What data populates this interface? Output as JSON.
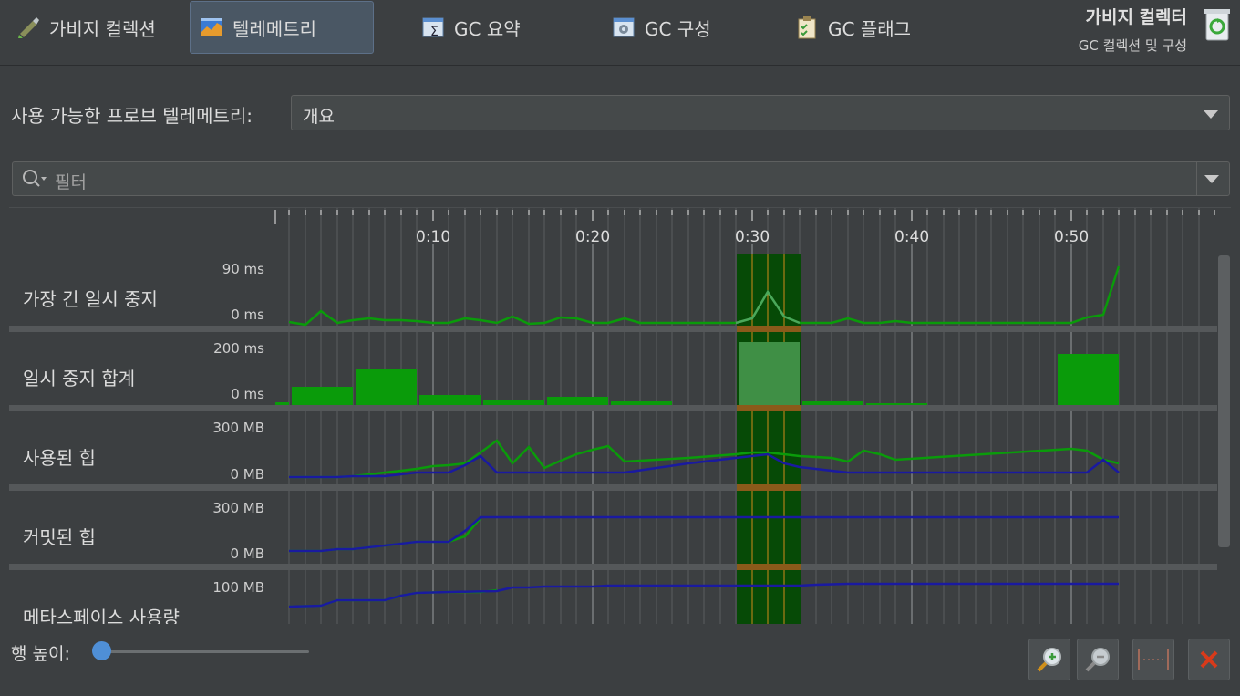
{
  "tabs": [
    {
      "label": "가비지 컬렉션",
      "icon": "garbage-collection-icon"
    },
    {
      "label": "텔레메트리",
      "icon": "telemetry-icon",
      "active": true
    },
    {
      "label": "GC 요약",
      "icon": "gc-summary-icon"
    },
    {
      "label": "GC 구성",
      "icon": "gc-config-icon"
    },
    {
      "label": "GC 플래그",
      "icon": "gc-flags-icon"
    }
  ],
  "header": {
    "title": "가비지 컬렉터",
    "subtitle": "GC 컬렉션 및 구성",
    "icon": "recycle-bin-icon"
  },
  "probe": {
    "label": "사용 가능한 프로브 텔레메트리:",
    "value": "개요"
  },
  "filter": {
    "placeholder": "필터"
  },
  "timeline": {
    "labels": [
      "0:10",
      "0:20",
      "0:30",
      "0:40",
      "0:50"
    ]
  },
  "rows": [
    {
      "name": "가장 긴 일시 중지",
      "max": "90 ms",
      "min": "0 ms"
    },
    {
      "name": "일시 중지 합계",
      "max": "200 ms",
      "min": "0 ms"
    },
    {
      "name": "사용된 힙",
      "max": "300 MB",
      "min": "0 MB"
    },
    {
      "name": "커밋된 힙",
      "max": "300 MB",
      "min": "0 MB"
    },
    {
      "name": "메타스페이스 사용량",
      "max": "100 MB",
      "min": ""
    }
  ],
  "footer": {
    "row_height_label": "행 높이:",
    "row_height_value": 0
  },
  "toolbar": [
    "zoom-in-icon",
    "zoom-out-icon",
    "fit-width-icon",
    "close-icon"
  ],
  "colors": {
    "green": "#0a9b0a",
    "blue": "#1a1aa0",
    "selection": "#064a06",
    "selection_line": "#d08a1a",
    "accent": "#4f8fd6"
  }
}
